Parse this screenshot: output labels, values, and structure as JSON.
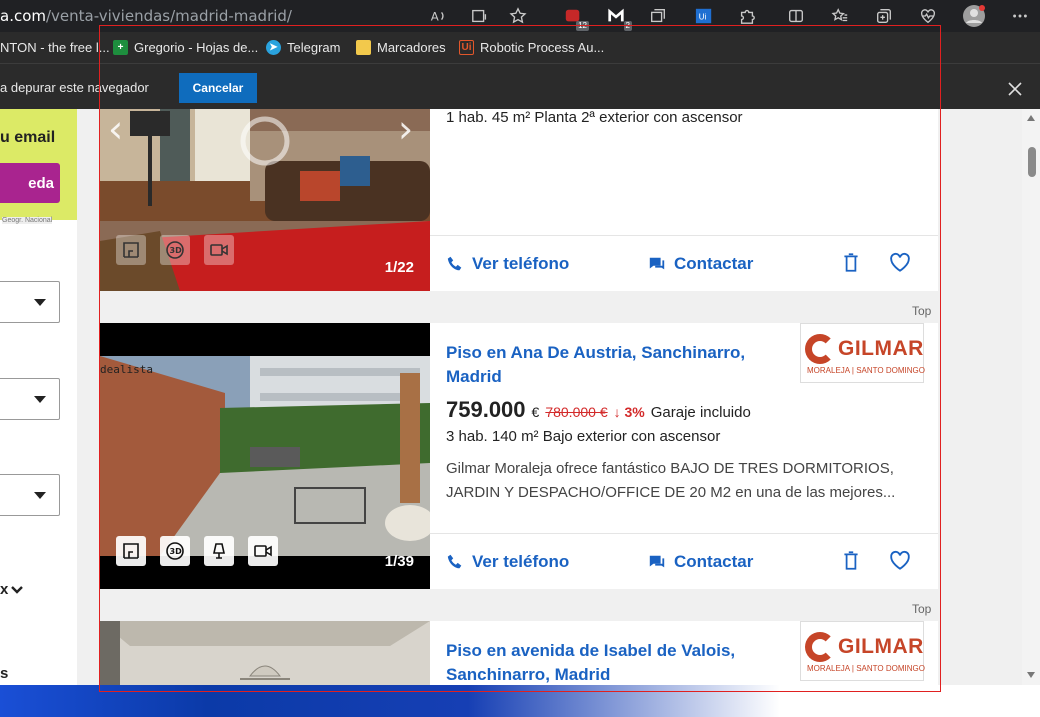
{
  "browser": {
    "url_host": "a.com",
    "url_path": "/venta-viviendas/madrid-madrid/",
    "extension_badges": {
      "ext1": "12",
      "ext2": "2"
    },
    "bookmarks": [
      {
        "label": "NTON - the free l..."
      },
      {
        "label": "Gregorio - Hojas de..."
      },
      {
        "label": "Telegram"
      },
      {
        "label": "Marcadores"
      },
      {
        "label": "Robotic Process Au..."
      }
    ],
    "infobar": {
      "text": "a depurar este navegador",
      "cancel_label": "Cancelar"
    }
  },
  "sidebar": {
    "promo_text": "u email",
    "promo_button": "eda",
    "map_credit": "Geogr. Nacional",
    "more_label": "x",
    "bottom_label": "s"
  },
  "listings": [
    {
      "details": "1 hab.   45 m²   Planta 2ª exterior con ascensor",
      "photo_counter": "1/22",
      "call_label": "Ver teléfono",
      "contact_label": "Contactar"
    },
    {
      "top_tag": "Top",
      "title": "Piso en Ana De Austria, Sanchinarro, Madrid",
      "price": "759.000",
      "currency": "€",
      "old_price": "780.000 €",
      "drop": "↓ 3%",
      "extra": "Garaje incluido",
      "details": "3 hab.   140 m²   Bajo exterior con ascensor",
      "description": "Gilmar Moraleja ofrece fantástico BAJO DE TRES DORMITORIOS, JARDIN Y DESPACHO/OFFICE DE 20 M2 en una de las mejores...",
      "photo_watermark": "dealista",
      "photo_counter": "1/39",
      "call_label": "Ver teléfono",
      "contact_label": "Contactar",
      "agency_name": "GILMAR",
      "agency_sub": "MORALEJA | SANTO DOMINGO"
    },
    {
      "top_tag": "Top",
      "title": "Piso en avenida de Isabel de Valois, Sanchinarro, Madrid",
      "agency_name": "GILMAR",
      "agency_sub": "MORALEJA | SANTO DOMINGO"
    }
  ],
  "colors": {
    "link_blue": "#1a62c2",
    "price_drop_red": "#d32a2a",
    "agency_red": "#c64528",
    "promo_yellow": "#dcea66",
    "promo_button": "#a9248f",
    "selection_border": "#e02020"
  }
}
